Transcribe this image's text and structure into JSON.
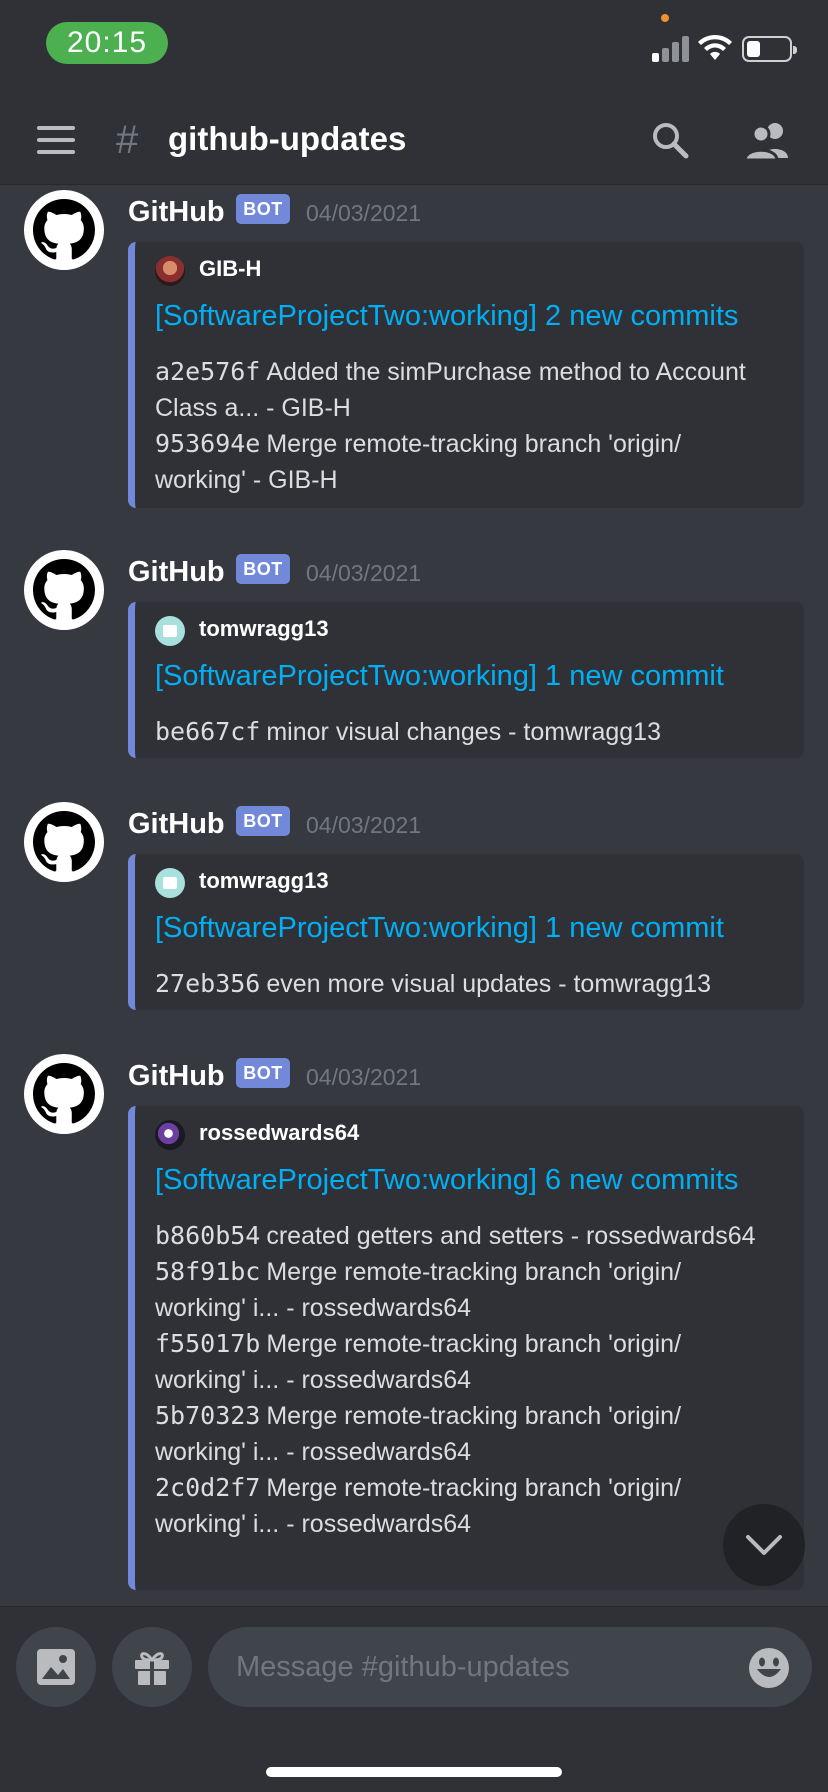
{
  "status_bar": {
    "time": "20:15"
  },
  "header": {
    "hash_symbol": "#",
    "channel_name": "github-updates"
  },
  "messages": [
    {
      "author": "GitHub",
      "tag": "BOT",
      "timestamp": "04/03/2021",
      "embed": {
        "author": "GIB-H",
        "title": "[SoftwareProjectTwo:working] 2 new commits",
        "commits": [
          {
            "hash": "a2e576f",
            "text": "Added the simPurchase method to Account Class a... - GIB-H"
          },
          {
            "hash": "953694e",
            "text": "Merge remote-tracking branch 'origin/ working' - GIB-H"
          }
        ]
      }
    },
    {
      "author": "GitHub",
      "tag": "BOT",
      "timestamp": "04/03/2021",
      "embed": {
        "author": "tomwragg13",
        "title": "[SoftwareProjectTwo:working] 1 new commit",
        "commits": [
          {
            "hash": "be667cf",
            "text": "minor visual changes - tomwragg13"
          }
        ]
      }
    },
    {
      "author": "GitHub",
      "tag": "BOT",
      "timestamp": "04/03/2021",
      "embed": {
        "author": "tomwragg13",
        "title": "[SoftwareProjectTwo:working] 1 new commit",
        "commits": [
          {
            "hash": "27eb356",
            "text": "even more visual updates - tomwragg13"
          }
        ]
      }
    },
    {
      "author": "GitHub",
      "tag": "BOT",
      "timestamp": "04/03/2021",
      "embed": {
        "author": "rossedwards64",
        "title": "[SoftwareProjectTwo:working] 6 new commits",
        "commits": [
          {
            "hash": "b860b54",
            "text": "created getters and setters - rossedwards64"
          },
          {
            "hash": "58f91bc",
            "text": "Merge remote-tracking branch 'origin/ working' i... - rossedwards64"
          },
          {
            "hash": "f55017b",
            "text": "Merge remote-tracking branch 'origin/ working' i... - rossedwards64"
          },
          {
            "hash": "5b70323",
            "text": "Merge remote-tracking branch 'origin/ working' i... - rossedwards64"
          },
          {
            "hash": "2c0d2f7",
            "text": "Merge remote-tracking branch 'origin/ working' i... - rossedwards64"
          }
        ]
      }
    }
  ],
  "composer": {
    "placeholder": "Message #github-updates"
  },
  "colors": {
    "background": "#36393f",
    "embed_bg": "#2f3136",
    "accent": "#7289da",
    "link": "#00aff4"
  }
}
